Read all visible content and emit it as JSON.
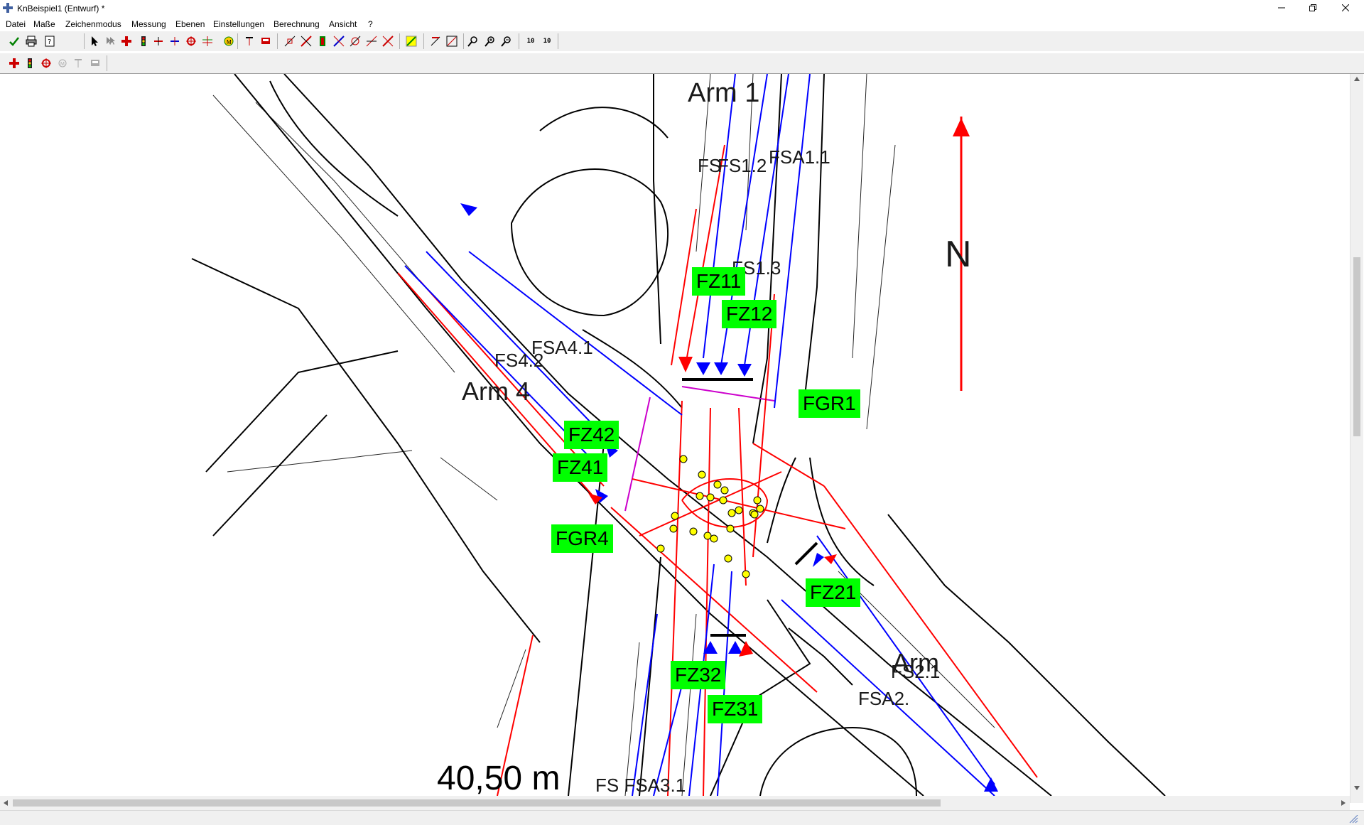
{
  "window": {
    "title": "KnBeispiel1 (Entwurf) *"
  },
  "menu": [
    "Datei",
    "Maße",
    "Zeichenmodus",
    "Messung",
    "Ebenen",
    "Einstellungen",
    "Berechnung",
    "Ansicht",
    "?"
  ],
  "toolbar": {
    "zoom_text_1": "10",
    "zoom_text_2": "10"
  },
  "plan": {
    "north_label": "N",
    "scale_label": "40,50 m",
    "arm_labels": {
      "arm1": "Arm 1",
      "arm4": "Arm 4",
      "arm2": "Arm"
    },
    "signal_groups": [
      {
        "id": "fz11",
        "label": "FZ11"
      },
      {
        "id": "fz12",
        "label": "FZ12"
      },
      {
        "id": "fgr1",
        "label": "FGR1"
      },
      {
        "id": "fz42",
        "label": "FZ42"
      },
      {
        "id": "fz41",
        "label": "FZ41"
      },
      {
        "id": "fgr4",
        "label": "FGR4"
      },
      {
        "id": "fz21",
        "label": "FZ21"
      },
      {
        "id": "fz32",
        "label": "FZ32"
      },
      {
        "id": "fz31",
        "label": "FZ31"
      }
    ],
    "stream_labels": {
      "fs12": "FS1.2",
      "fs1": "FS",
      "fsa11": "FSA1.1",
      "fs13": "FS1.3",
      "fsa41": "FSA4.1",
      "fs42": "FS4.2",
      "fs21": "FS2.1",
      "fsa2": "FSA2.",
      "fs3": "FS FSA3.1"
    },
    "colors": {
      "label_bg": "#00ff00",
      "signal_red": "#ff0000",
      "lane_blue": "#0000ff",
      "ped_magenta": "#cc00cc",
      "conflict_yellow": "#ffff00"
    }
  }
}
